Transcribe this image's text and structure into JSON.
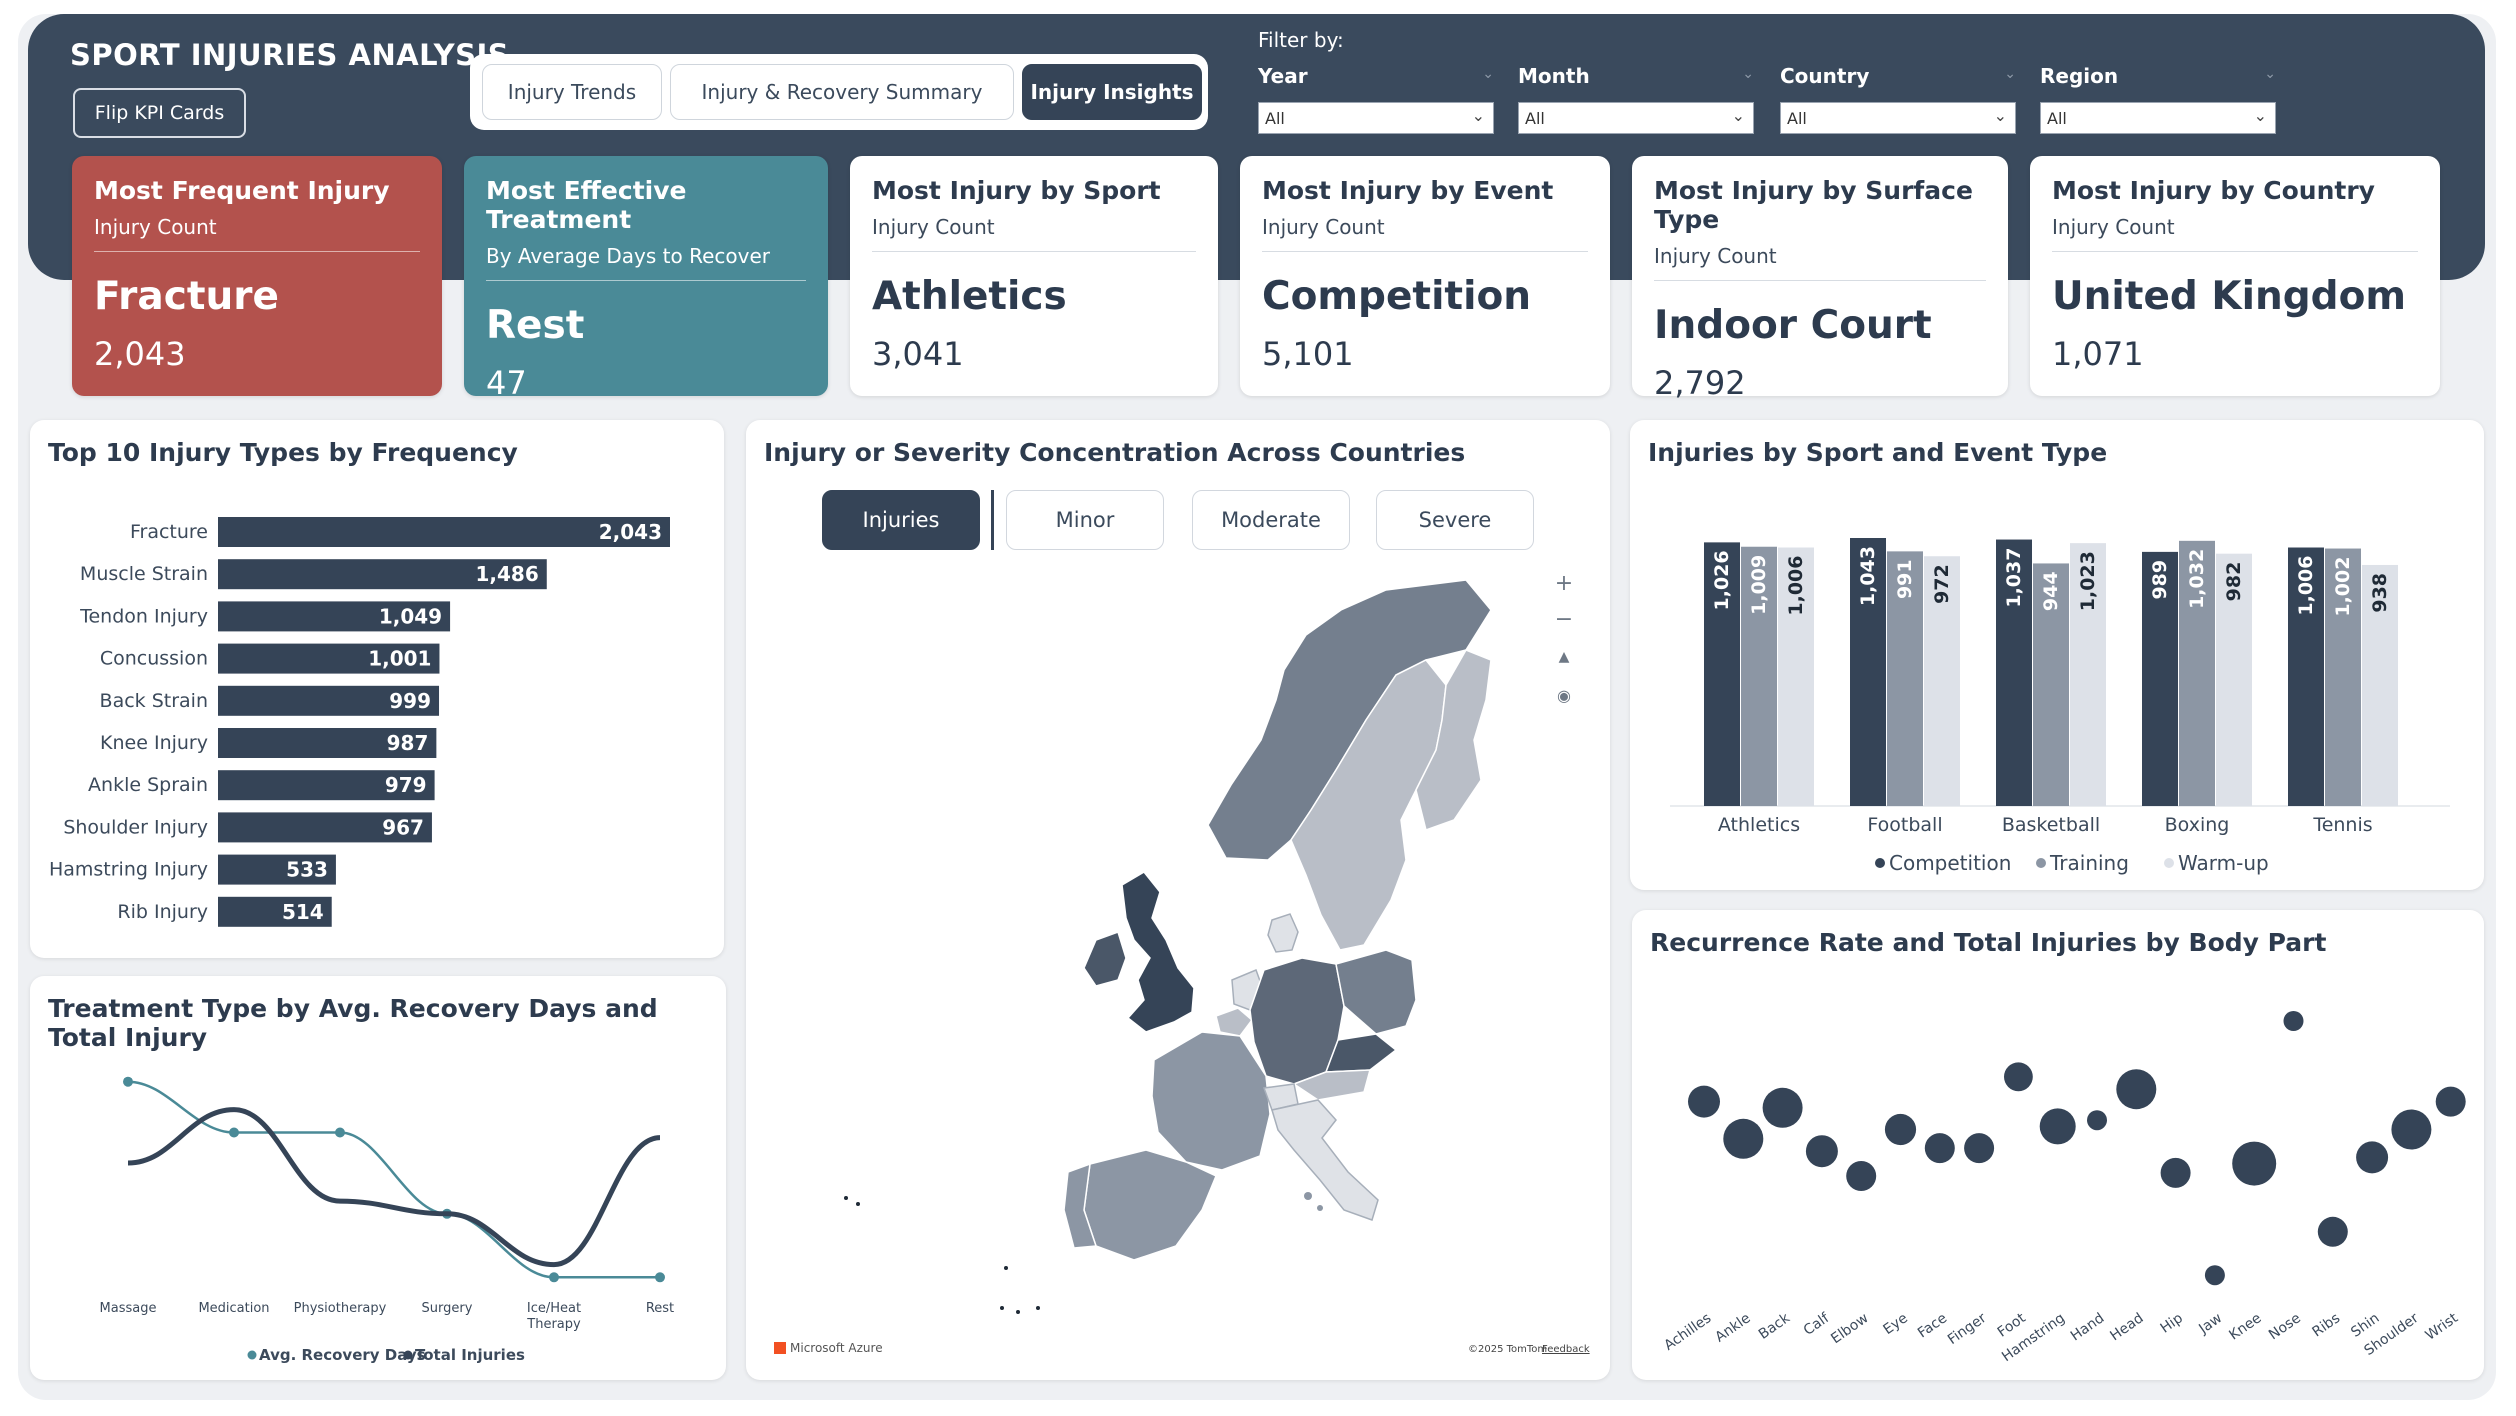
{
  "header": {
    "title": "SPORT INJURIES ANALYSIS",
    "flip_button": "Flip KPI Cards",
    "tabs": [
      "Injury Trends",
      "Injury & Recovery Summary",
      "Injury Insights"
    ],
    "active_tab": "Injury Insights",
    "filter_title": "Filter by:",
    "filters": [
      {
        "label": "Year",
        "value": "All"
      },
      {
        "label": "Month",
        "value": "All"
      },
      {
        "label": "Country",
        "value": "All"
      },
      {
        "label": "Region",
        "value": "All"
      }
    ]
  },
  "kpis": [
    {
      "title": "Most Frequent Injury",
      "subtitle": "Injury Count",
      "value": "Fracture",
      "number": "2,043"
    },
    {
      "title": "Most Effective Treatment",
      "subtitle": "By Average Days to Recover",
      "value": "Rest",
      "number": "47"
    },
    {
      "title": "Most Injury by Sport",
      "subtitle": "Injury Count",
      "value": "Athletics",
      "number": "3,041"
    },
    {
      "title": "Most Injury by Event",
      "subtitle": "Injury Count",
      "value": "Competition",
      "number": "5,101"
    },
    {
      "title": "Most Injury by Surface Type",
      "subtitle": "Injury Count",
      "value": "Indoor Court",
      "number": "2,792"
    },
    {
      "title": "Most Injury by Country",
      "subtitle": "Injury Count",
      "value": "United Kingdom",
      "number": "1,071"
    }
  ],
  "colors": {
    "header_bg": "#3a4a5d",
    "kpi_red": "#b3524d",
    "kpi_teal": "#4a8a97",
    "dark": "#354457",
    "mid": "#8c96a4",
    "light": "#dde1e8",
    "teal_line": "#4a8a97"
  },
  "map": {
    "title": "Injury or Severity Concentration Across Countries",
    "buttons": [
      "Injuries",
      "Minor",
      "Moderate",
      "Severe"
    ],
    "active_button": "Injuries",
    "controls": [
      "zoom-in",
      "zoom-out",
      "reset",
      "location"
    ],
    "credit_left": "Microsoft Azure",
    "credit_right": "©2025 TomTom",
    "credit_feedback": "Feedback"
  },
  "chart_data": [
    {
      "type": "bar",
      "orientation": "horizontal",
      "title": "Top 10 Injury Types by Frequency",
      "categories": [
        "Fracture",
        "Muscle Strain",
        "Tendon Injury",
        "Concussion",
        "Back Strain",
        "Knee Injury",
        "Ankle Sprain",
        "Shoulder Injury",
        "Hamstring Injury",
        "Rib Injury"
      ],
      "values": [
        2043,
        1486,
        1049,
        1001,
        999,
        987,
        979,
        967,
        533,
        514
      ],
      "labels": [
        "2,043",
        "1,486",
        "1,049",
        "1,001",
        "999",
        "987",
        "979",
        "967",
        "533",
        "514"
      ]
    },
    {
      "type": "bar",
      "orientation": "vertical",
      "title": "Injuries by Sport and Event Type",
      "categories": [
        "Athletics",
        "Football",
        "Basketball",
        "Boxing",
        "Tennis"
      ],
      "series": [
        {
          "name": "Competition",
          "values": [
            1026,
            1043,
            1037,
            989,
            1006
          ],
          "labels": [
            "1,026",
            "1,043",
            "1,037",
            "989",
            "1,006"
          ]
        },
        {
          "name": "Training",
          "values": [
            1009,
            991,
            944,
            1032,
            1002
          ],
          "labels": [
            "1,009",
            "991",
            "944",
            "1,032",
            "1,002"
          ]
        },
        {
          "name": "Warm-up",
          "values": [
            1006,
            972,
            1023,
            982,
            938
          ],
          "labels": [
            "1,006",
            "972",
            "1,023",
            "982",
            "938"
          ]
        }
      ],
      "legend": "bottom"
    },
    {
      "type": "line",
      "title": "Treatment Type by Avg. Recovery Days and Total Injury",
      "categories": [
        "Massage",
        "Medication",
        "Physiotherapy",
        "Surgery",
        "Ice/Heat Therapy",
        "Rest"
      ],
      "series": [
        {
          "name": "Avg. Recovery Days",
          "values": [
            0.82,
            0.62,
            0.62,
            0.3,
            0.05,
            0.05
          ]
        },
        {
          "name": "Total Injuries",
          "values": [
            0.5,
            0.71,
            0.35,
            0.3,
            0.1,
            0.6
          ]
        }
      ],
      "note": "values normalized 0-1 (no y-axis shown)",
      "legend": "bottom"
    },
    {
      "type": "scatter",
      "title": "Recurrence Rate and Total Injuries by Body Part",
      "categories": [
        "Achilles",
        "Ankle",
        "Back",
        "Calf",
        "Elbow",
        "Eye",
        "Face",
        "Finger",
        "Foot",
        "Hamstring",
        "Hand",
        "Head",
        "Hip",
        "Jaw",
        "Knee",
        "Nose",
        "Ribs",
        "Shin",
        "Shoulder",
        "Wrist"
      ],
      "y": [
        0.64,
        0.52,
        0.62,
        0.48,
        0.4,
        0.55,
        0.49,
        0.49,
        0.72,
        0.56,
        0.58,
        0.68,
        0.41,
        0.08,
        0.44,
        0.9,
        0.22,
        0.46,
        0.55,
        0.64
      ],
      "size": [
        0.5,
        0.7,
        0.7,
        0.5,
        0.45,
        0.48,
        0.45,
        0.45,
        0.42,
        0.6,
        0.2,
        0.7,
        0.45,
        0.2,
        0.8,
        0.2,
        0.45,
        0.5,
        0.7,
        0.45
      ],
      "note": "normalized recurrence (y) and bubble size (no axes shown)"
    }
  ]
}
